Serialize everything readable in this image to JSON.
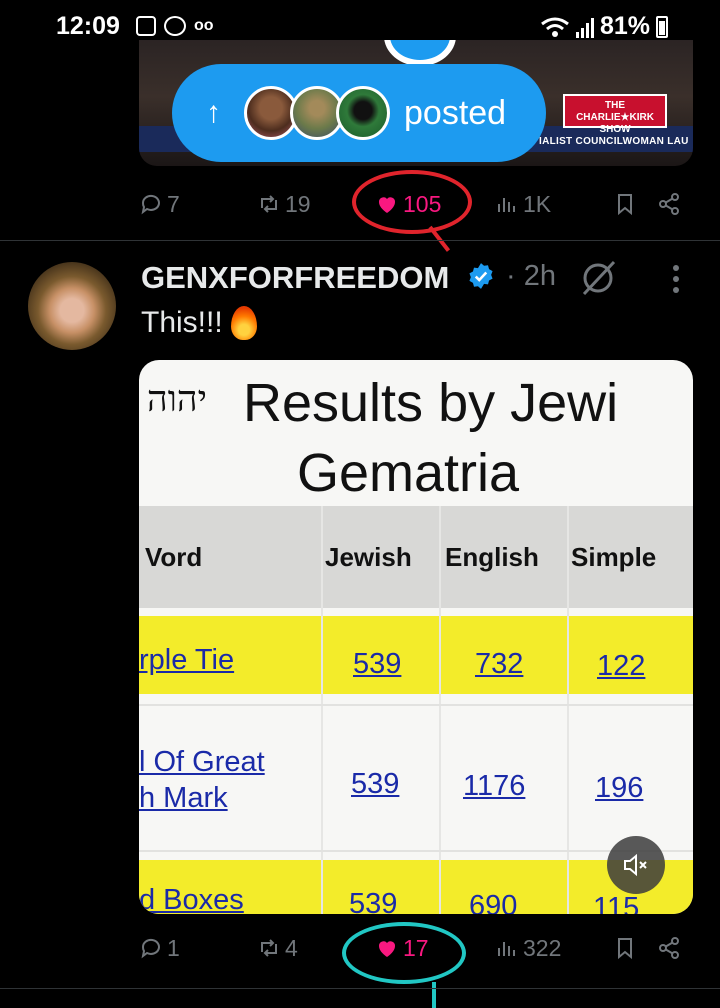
{
  "status_bar": {
    "time": "12:09",
    "battery_label": "81%",
    "icons": [
      "gallery-icon",
      "pluto-tv-icon",
      "voicemail-icon",
      "wifi-icon",
      "signal-icon",
      "battery-icon"
    ]
  },
  "previous_post": {
    "lower_third_text": "IALIST COUNCILWOMAN LAU",
    "show_badge": "THE CHARLIE★KIRK SHOW",
    "posted_pill": {
      "arrow": "↑",
      "label": "posted"
    },
    "actions": {
      "replies": "7",
      "reposts": "19",
      "likes": "105",
      "views": "1K"
    }
  },
  "post": {
    "username": "GENXFORFREEDOM",
    "time": "· 2h",
    "text": "This!!!",
    "media": {
      "hebrew_mark": "יהוה",
      "title_line1": "Results by Jewi",
      "title_line2": "Gematria",
      "headers": [
        "Vord",
        "Jewish",
        "English",
        "Simple"
      ],
      "rows": [
        {
          "word_line1": "rple Tie",
          "word_line2": "",
          "jewish": "539",
          "english": "732",
          "simple": "122"
        },
        {
          "word_line1": "l Of Great",
          "word_line2": "h Mark",
          "jewish": "539",
          "english": "1176",
          "simple": "196"
        },
        {
          "word_line1": "d Boxes",
          "word_line2": "",
          "jewish": "539",
          "english": "690",
          "simple": "115"
        }
      ]
    },
    "actions": {
      "replies": "1",
      "reposts": "4",
      "likes": "17",
      "views": "322"
    }
  },
  "colors": {
    "accent_blue": "#1d9bf0",
    "like_pink": "#f91880",
    "muted_gray": "#71767b",
    "highlight_yellow": "#f3ec2a",
    "annotation_red": "#e0242c",
    "annotation_teal": "#21c7c4"
  }
}
